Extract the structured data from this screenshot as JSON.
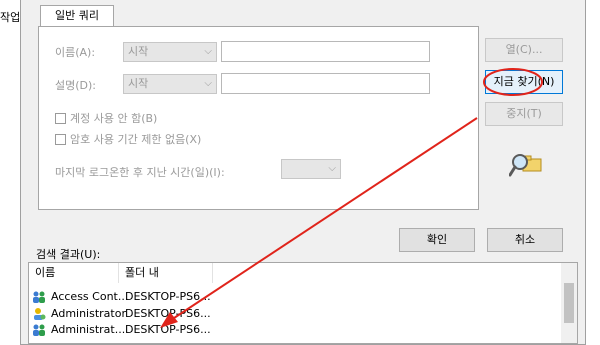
{
  "background": {
    "partial_text": "작업"
  },
  "dialog": {
    "tab": {
      "label": "일반 쿼리"
    },
    "fields": {
      "name": {
        "label": "이름(A):",
        "mode": "시작",
        "value": ""
      },
      "description": {
        "label": "설명(D):",
        "mode": "시작",
        "value": ""
      }
    },
    "checkboxes": [
      {
        "label": "계정 사용 안 함(B)",
        "checked": false
      },
      {
        "label": "암호 사용 기간 제한 없음(X)",
        "checked": false
      }
    ],
    "last_logon": {
      "label": "마지막 로그온한 후 지난 시간(일)(I):",
      "value": ""
    },
    "buttons": {
      "columns": "열(C)...",
      "find_now": "지금 찾기(N)",
      "stop": "중지(T)",
      "ok": "확인",
      "cancel": "취소"
    },
    "results": {
      "label": "검색 결과(U):",
      "columns": [
        "이름",
        "폴더 내"
      ],
      "rows": [
        {
          "name": "Access Cont...",
          "folder": "DESKTOP-PS6..."
        },
        {
          "name": "Administrator",
          "folder": "DESKTOP-PS6..."
        },
        {
          "name": "Administrat...",
          "folder": "DESKTOP-PS6..."
        }
      ]
    }
  },
  "icons": {
    "search_dialog": "search-magnifier-icon",
    "group": "user-group-icon"
  },
  "colors": {
    "annotation": "#e0241b",
    "primary_border": "#0078d7"
  }
}
